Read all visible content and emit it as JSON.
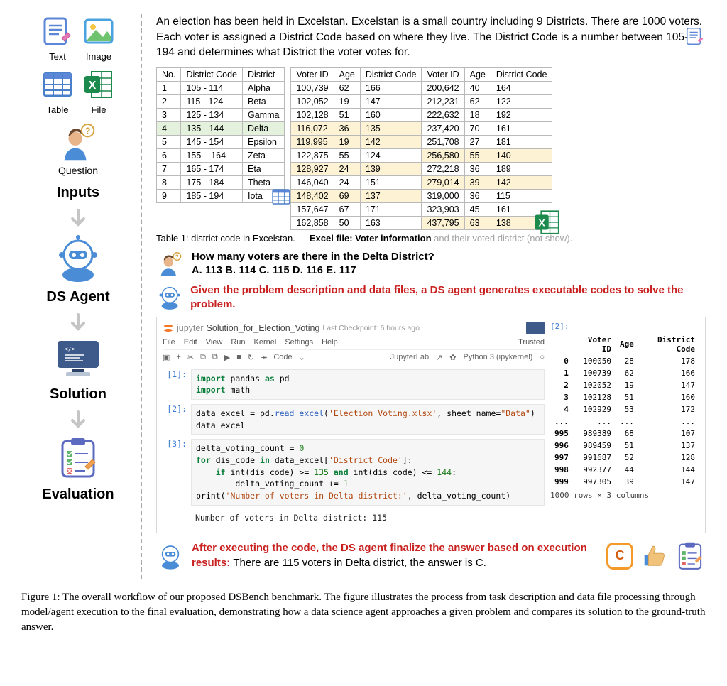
{
  "left": {
    "icons": {
      "text": "Text",
      "image": "Image",
      "table": "Table",
      "file": "File",
      "question": "Question"
    },
    "stages": {
      "inputs": "Inputs",
      "agent": "DS Agent",
      "solution": "Solution",
      "evaluation": "Evaluation"
    }
  },
  "description": "An election has been held in Excelstan. Excelstan is a small country including 9 Districts. There are 1000 voters. Each voter is assigned a District Code based on where they live. The District Code is a number between 105-194 and determines what District the voter votes for.",
  "table1": {
    "headers": [
      "No.",
      "District Code",
      "District"
    ],
    "rows": [
      [
        "1",
        "105 - 114",
        "Alpha"
      ],
      [
        "2",
        "115 - 124",
        "Beta"
      ],
      [
        "3",
        "125 - 134",
        "Gamma"
      ],
      [
        "4",
        "135 - 144",
        "Delta"
      ],
      [
        "5",
        "145 - 154",
        "Epsilon"
      ],
      [
        "6",
        "155 – 164",
        "Zeta"
      ],
      [
        "7",
        "165 - 174",
        "Eta"
      ],
      [
        "8",
        "175 - 184",
        "Theta"
      ],
      [
        "9",
        "185 - 194",
        "Iota"
      ]
    ],
    "highlight_row_index": 3
  },
  "table2": {
    "headers": [
      "Voter ID",
      "Age",
      "District Code",
      "Voter ID",
      "Age",
      "District Code"
    ],
    "rows": [
      {
        "c": [
          "100,739",
          "62",
          "166",
          "200,642",
          "40",
          "164"
        ],
        "hl": []
      },
      {
        "c": [
          "102,052",
          "19",
          "147",
          "212,231",
          "62",
          "122"
        ],
        "hl": []
      },
      {
        "c": [
          "102,128",
          "51",
          "160",
          "222,632",
          "18",
          "192"
        ],
        "hl": []
      },
      {
        "c": [
          "116,072",
          "36",
          "135",
          "237,420",
          "70",
          "161"
        ],
        "hl": [
          0,
          1,
          2
        ]
      },
      {
        "c": [
          "119,995",
          "19",
          "142",
          "251,708",
          "27",
          "181"
        ],
        "hl": [
          0,
          1,
          2
        ]
      },
      {
        "c": [
          "122,875",
          "55",
          "124",
          "256,580",
          "55",
          "140"
        ],
        "hl": [
          3,
          4,
          5
        ]
      },
      {
        "c": [
          "128,927",
          "24",
          "139",
          "272,218",
          "36",
          "189"
        ],
        "hl": [
          0,
          1,
          2
        ]
      },
      {
        "c": [
          "146,040",
          "24",
          "151",
          "279,014",
          "39",
          "142"
        ],
        "hl": [
          3,
          4,
          5
        ]
      },
      {
        "c": [
          "148,402",
          "69",
          "137",
          "319,000",
          "36",
          "115"
        ],
        "hl": [
          0,
          1,
          2
        ]
      },
      {
        "c": [
          "157,647",
          "67",
          "171",
          "323,903",
          "45",
          "161"
        ],
        "hl": []
      },
      {
        "c": [
          "162,858",
          "50",
          "163",
          "437,795",
          "63",
          "138"
        ],
        "hl": [
          3,
          4,
          5
        ]
      }
    ]
  },
  "captions": {
    "t1": "Table 1: district code in Excelstan.",
    "t2a": "Excel file: Voter information",
    "t2b": " and their voted district (not show)."
  },
  "question": {
    "text": "How many voters are there in the Delta District?",
    "options": "A. 113   B. 114   C. 115   D. 116   E. 117"
  },
  "agent_prompt": "Given the problem description and data files, a DS agent generates executable codes to solve the problem.",
  "jupyter": {
    "title": "Solution_for_Election_Voting",
    "checkpoint": "Last Checkpoint: 6 hours ago",
    "trusted": "Trusted",
    "menu": [
      "File",
      "Edit",
      "View",
      "Run",
      "Kernel",
      "Settings",
      "Help"
    ],
    "toolbar": {
      "code": "Code",
      "lab": "JupyterLab",
      "kernel": "Python 3 (ipykernel)"
    },
    "out_prompt": "[2]:",
    "cell1": {
      "prompt": "[1]:",
      "l1a": "import",
      "l1b": " pandas ",
      "l1c": "as",
      "l1d": " pd",
      "l2a": "import",
      "l2b": " math"
    },
    "cell2": {
      "prompt": "[2]:",
      "l1": "data_excel = pd.",
      "l1b": "read_excel",
      "l1c": "(",
      "s1": "'Election_Voting.xlsx'",
      "l1d": ", sheet_name=",
      "s2": "\"Data\"",
      "l1e": ")",
      "l2": "data_excel"
    },
    "cell3": {
      "prompt": "[3]:",
      "l1": "delta_voting_count = ",
      "n0": "0",
      "l2": "for",
      "l2b": " dis_code ",
      "l2c": "in",
      "l2d": " data_excel[",
      "s1": "'District Code'",
      "l2e": "]:",
      "l3": "    if",
      "l3b": " int(dis_code) >= ",
      "n1": "135",
      "l3c": " and",
      "l3d": " int(dis_code) <= ",
      "n2": "144",
      "l3e": ":",
      "l4": "        delta_voting_count += ",
      "n3": "1",
      "l5a": "print(",
      "s2": "'Number of voters in Delta district:'",
      "l5b": ", delta_voting_count)"
    },
    "output": "Number of voters in Delta district: 115",
    "df": {
      "headers": [
        "",
        "Voter ID",
        "Age",
        "District Code"
      ],
      "rows": [
        [
          "0",
          "100050",
          "28",
          "178"
        ],
        [
          "1",
          "100739",
          "62",
          "166"
        ],
        [
          "2",
          "102052",
          "19",
          "147"
        ],
        [
          "3",
          "102128",
          "51",
          "160"
        ],
        [
          "4",
          "102929",
          "53",
          "172"
        ],
        [
          "...",
          "...",
          "...",
          "..."
        ],
        [
          "995",
          "989389",
          "68",
          "107"
        ],
        [
          "996",
          "989459",
          "51",
          "137"
        ],
        [
          "997",
          "991687",
          "52",
          "128"
        ],
        [
          "998",
          "992377",
          "44",
          "144"
        ],
        [
          "999",
          "997305",
          "39",
          "147"
        ]
      ],
      "footer": "1000 rows × 3 columns"
    }
  },
  "final": {
    "red": "After executing the code, the DS agent finalize the answer based on execution results: ",
    "rest": "There are 115 voters in Delta district, the answer is C.",
    "badge": "C"
  },
  "figure_caption": "Figure 1: The overall workflow of our proposed DSBench benchmark. The figure illustrates the process from task description and data file processing through model/agent execution to the final evaluation, demonstrating how a data science agent approaches a given problem and compares its solution to the ground-truth answer."
}
